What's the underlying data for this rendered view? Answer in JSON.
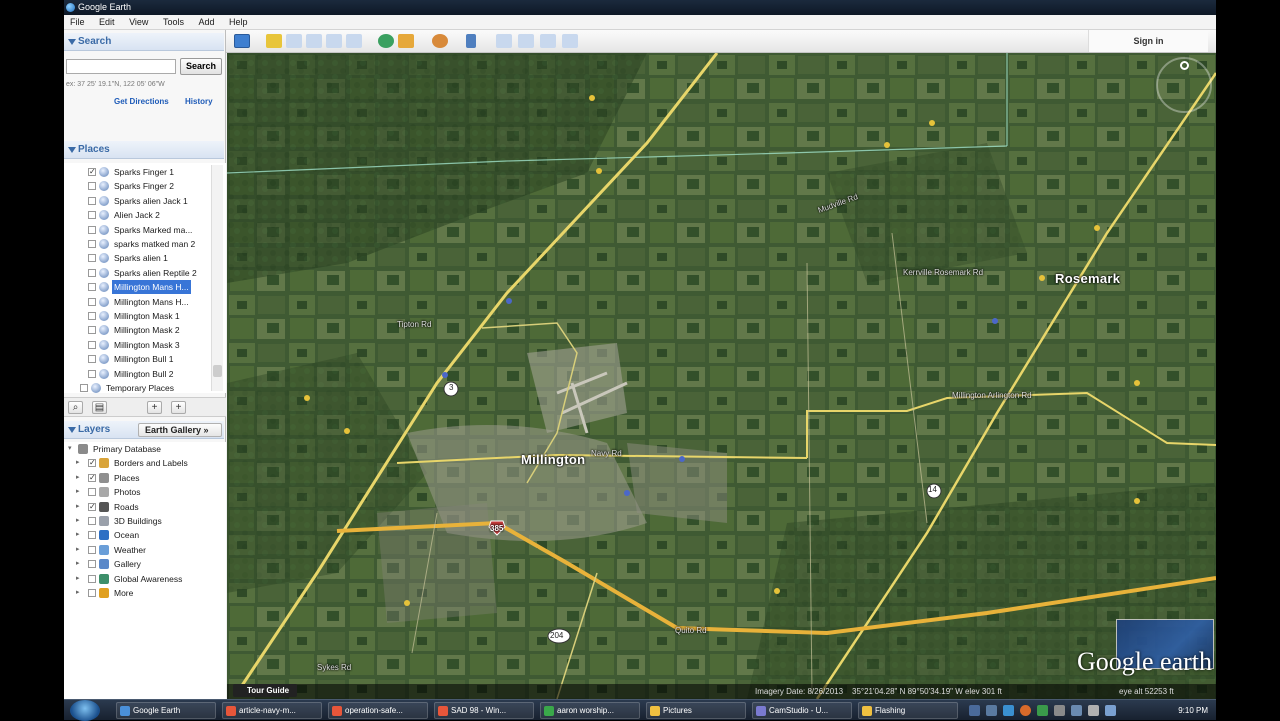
{
  "window": {
    "title": "Google Earth"
  },
  "menu": [
    "File",
    "Edit",
    "View",
    "Tools",
    "Add",
    "Help"
  ],
  "toolbar": {
    "sign_in": "Sign in"
  },
  "search": {
    "header": "Search",
    "input_value": "",
    "button": "Search",
    "hint": "ex: 37 25' 19.1\"N, 122 05' 06\"W",
    "get_directions": "Get Directions",
    "history": "History"
  },
  "places": {
    "header": "Places",
    "items": [
      {
        "label": "Sparks Finger 1",
        "checked": true
      },
      {
        "label": "Sparks Finger 2",
        "checked": false
      },
      {
        "label": "Sparks alien Jack 1",
        "checked": false
      },
      {
        "label": "Alien Jack 2",
        "checked": false
      },
      {
        "label": "Sparks Marked ma...",
        "checked": false
      },
      {
        "label": "sparks matked man 2",
        "checked": false
      },
      {
        "label": "Sparks alien 1",
        "checked": false
      },
      {
        "label": "Sparks alien Reptile 2",
        "checked": false
      },
      {
        "label": "Millington Mans H...",
        "checked": false,
        "selected": true
      },
      {
        "label": "Millington Mans H...",
        "checked": false
      },
      {
        "label": "Millington Mask 1",
        "checked": false
      },
      {
        "label": "Millington Mask 2",
        "checked": false
      },
      {
        "label": "Millington Mask 3",
        "checked": false
      },
      {
        "label": "Millington Bull 1",
        "checked": false
      },
      {
        "label": "Millington Bull 2",
        "checked": false
      },
      {
        "label": "Temporary Places",
        "checked": false
      }
    ]
  },
  "layers": {
    "header": "Layers",
    "gallery_button": "Earth Gallery »",
    "items": [
      {
        "label": "Primary Database",
        "checked": null,
        "icon": "database-icon",
        "color": "#8a8a8a"
      },
      {
        "label": "Borders and Labels",
        "checked": true,
        "icon": "borders-icon",
        "color": "#d9a43a"
      },
      {
        "label": "Places",
        "checked": true,
        "icon": "places-icon",
        "color": "#8f8f8f"
      },
      {
        "label": "Photos",
        "checked": false,
        "icon": "photos-icon",
        "color": "#a8a8a8"
      },
      {
        "label": "Roads",
        "checked": true,
        "icon": "roads-icon",
        "color": "#555555"
      },
      {
        "label": "3D Buildings",
        "checked": false,
        "icon": "buildings-icon",
        "color": "#9aa0aa"
      },
      {
        "label": "Ocean",
        "checked": false,
        "icon": "ocean-icon",
        "color": "#2e6fc4"
      },
      {
        "label": "Weather",
        "checked": false,
        "icon": "weather-icon",
        "color": "#6a9ed8"
      },
      {
        "label": "Gallery",
        "checked": false,
        "icon": "gallery-icon",
        "color": "#5a88c9"
      },
      {
        "label": "Global Awareness",
        "checked": false,
        "icon": "globe-icon",
        "color": "#3d8f6a"
      },
      {
        "label": "More",
        "checked": false,
        "icon": "more-icon",
        "color": "#e0a020"
      }
    ]
  },
  "map": {
    "labels": {
      "rosemark": "Rosemark",
      "millington": "Millington",
      "route3": "3",
      "route14": "14",
      "i385": "385",
      "route204": "204",
      "sykes": "Sykes Rd",
      "navy": "Navy Rd",
      "tipton": "Tipton Rd",
      "kerrville": "Kerrville Rosemark Rd",
      "mudville": "Mudville Rd",
      "millington_arlington": "Millington Arlington Rd",
      "quito": "Quito Rd"
    },
    "tour_guide": "Tour Guide",
    "status": {
      "imagery_date": "Imagery Date: 8/26/2013",
      "coords": "35°21'04.28\" N  89°50'34.19\" W  elev  301 ft",
      "eye_alt": "eye alt  52253 ft"
    },
    "logo": "Google earth"
  },
  "taskbar": {
    "items": [
      {
        "label": "Google Earth",
        "color": "#4a90d9"
      },
      {
        "label": "article-navy-m...",
        "color": "#e8563a"
      },
      {
        "label": "operation-safe...",
        "color": "#e8563a"
      },
      {
        "label": "SAD 98 - Win...",
        "color": "#e8563a"
      },
      {
        "label": "aaron worship...",
        "color": "#3aa84a"
      },
      {
        "label": "Pictures",
        "color": "#f0c040"
      },
      {
        "label": "CamStudio - U...",
        "color": "#7a7ad0"
      },
      {
        "label": "Flashing",
        "color": "#f0c040"
      }
    ],
    "clock": "9:10 PM"
  }
}
